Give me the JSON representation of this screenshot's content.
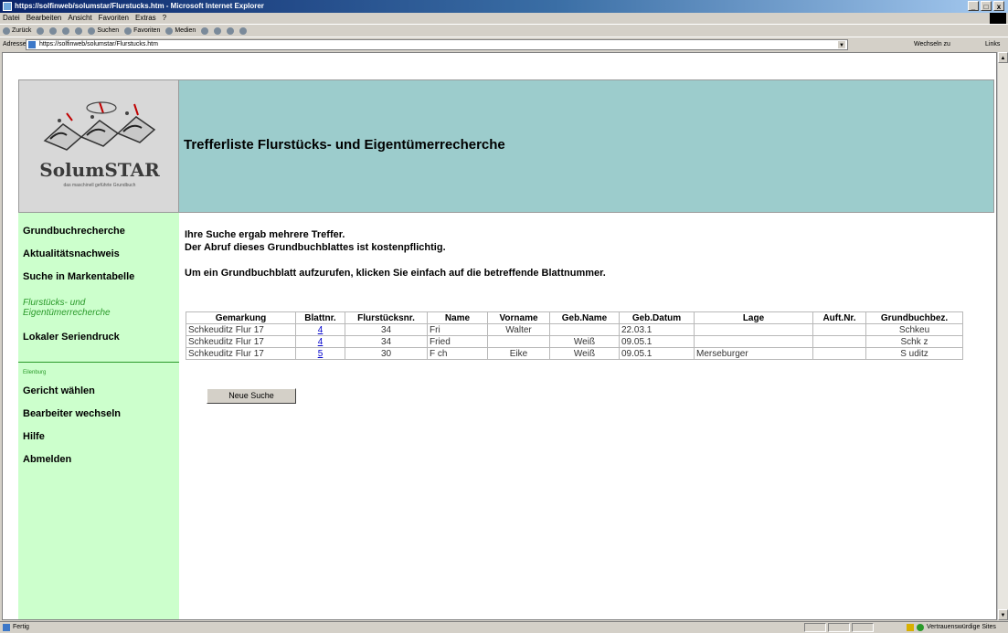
{
  "window": {
    "title": "https://solfinweb/solumstar/Flurstucks.htm - Microsoft Internet Explorer",
    "controls": [
      "_",
      "□",
      "x"
    ]
  },
  "menu": [
    "Datei",
    "Bearbeiten",
    "Ansicht",
    "Favoriten",
    "Extras",
    "?"
  ],
  "toolbar": {
    "back": "Zurück",
    "search": "Suchen",
    "favorites": "Favoriten",
    "media": "Medien"
  },
  "address": {
    "label": "Adresse",
    "url": "https://solfinweb/solumstar/Flurstucks.htm",
    "go": "Wechseln zu",
    "links": "Links"
  },
  "logo": {
    "name": "SolumSTAR",
    "tagline": "das maschinell geführte Grundbuch"
  },
  "header": {
    "title": "Trefferliste Flurstücks- und Eigentümerrecherche"
  },
  "sidebar": {
    "items": [
      "Grundbuchrecherche",
      "Aktualitätsnachweis",
      "Suche in Markentabelle",
      "Flurstücks- und",
      "Eigentümerrecherche",
      "Lokaler Seriendruck"
    ],
    "section_label": "Eilenburg",
    "items2": [
      "Gericht wählen",
      "Bearbeiter wechseln",
      "Hilfe",
      "Abmelden"
    ]
  },
  "content": {
    "message1": "Ihre Suche ergab mehrere Treffer.",
    "message2": "Der Abruf dieses Grundbuchblattes ist kostenpflichtig.",
    "message3": "Um ein Grundbuchblatt aufzurufen, klicken Sie einfach auf die betreffende Blattnummer.",
    "new_search_label": "Neue Suche"
  },
  "table": {
    "headers": [
      "Gemarkung",
      "Blattnr.",
      "Flurstücksnr.",
      "Name",
      "Vorname",
      "Geb.Name",
      "Geb.Datum",
      "Lage",
      "Auft.Nr.",
      "Grundbuchbez."
    ],
    "rows": [
      [
        "Schkeuditz Flur 17",
        "4",
        "34",
        "Fri",
        "Walter",
        "",
        "22.03.1",
        "",
        "",
        "Schkeu"
      ],
      [
        "Schkeuditz Flur 17",
        "4",
        "34",
        "Fried",
        "",
        "Weiß",
        "09.05.1",
        "",
        "",
        "Schk    z"
      ],
      [
        "Schkeuditz Flur 17",
        "5",
        "30",
        "F   ch",
        "Eike",
        "Weiß",
        "09.05.1",
        "Merseburger",
        "",
        "S   uditz"
      ]
    ]
  },
  "status": {
    "left": "Fertig",
    "zone": "Vertrauenswürdige Sites"
  }
}
